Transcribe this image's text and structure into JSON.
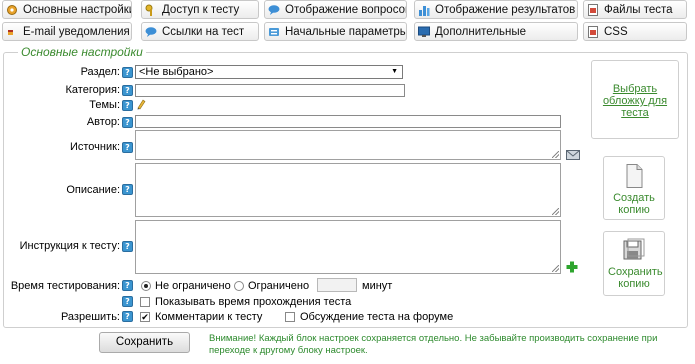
{
  "tabs": [
    {
      "label": "Основные настройки",
      "icon": "gear-icon"
    },
    {
      "label": "Доступ к тесту",
      "icon": "key-icon"
    },
    {
      "label": "Отображение вопросов",
      "icon": "speech-bubble-icon"
    },
    {
      "label": "Отображение результатов",
      "icon": "bar-chart-icon"
    },
    {
      "label": "Файлы теста",
      "icon": "file-icon"
    },
    {
      "label": "E-mail уведомления",
      "icon": "mail-icon"
    },
    {
      "label": "Ссылки на тест",
      "icon": "link-icon"
    },
    {
      "label": "Начальные параметры",
      "icon": "sliders-icon"
    },
    {
      "label": "Дополнительные",
      "icon": "monitor-icon"
    },
    {
      "label": "CSS",
      "icon": "css-icon"
    }
  ],
  "section_title": "Основные настройки",
  "fields": {
    "section_label": "Раздел:",
    "section_value": "<Не выбрано>",
    "category_label": "Категория:",
    "category_value": "",
    "topics_label": "Темы:",
    "author_label": "Автор:",
    "author_value": "",
    "source_label": "Источник:",
    "description_label": "Описание:",
    "instruction_label": "Инструкция к тесту:",
    "time_label": "Время тестирования:",
    "time_unlimited": "Не ограничено",
    "time_limited": "Ограничено",
    "time_value": "",
    "time_unit": "минут",
    "show_time": "Показывать время прохождения теста",
    "allow_label": "Разрешить:",
    "allow_comments": "Комментарии к тесту",
    "allow_forum": "Обсуждение теста на форуме"
  },
  "states": {
    "time_mode": "unlimited",
    "show_time": false,
    "allow_comments": true,
    "allow_forum": false
  },
  "side": {
    "cover_link": "Выбрать обложку для теста",
    "create_copy": "Создать копию",
    "save_copy": "Сохранить копию"
  },
  "save_button": "Сохранить",
  "warning": "Внимание! Каждый блок настроек сохраняется отдельно. Не забывайте производить сохранение при переходе к другому блоку настроек.",
  "colors": {
    "accent_green": "#3a8a2e",
    "help_blue": "#3b95d0"
  }
}
